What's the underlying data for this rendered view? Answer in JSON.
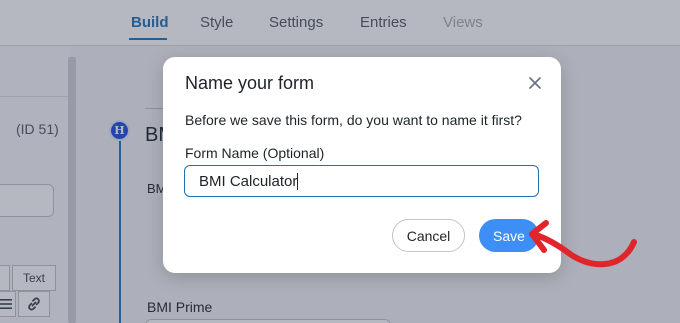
{
  "top_nav": {
    "tabs": [
      {
        "label": "Build",
        "state": "active"
      },
      {
        "label": "Style",
        "state": "normal"
      },
      {
        "label": "Settings",
        "state": "normal"
      },
      {
        "label": "Entries",
        "state": "normal"
      },
      {
        "label": "Views",
        "state": "disabled"
      }
    ]
  },
  "left_panel": {
    "form_id": "(ID 51)",
    "toolbar": {
      "text_tab": "Text"
    }
  },
  "canvas": {
    "heading_partial": "BMI",
    "label_partial": "BM",
    "bmi_prime_label": "BMI Prime"
  },
  "modal": {
    "title": "Name your form",
    "description": "Before we save this form, do you want to name it first?",
    "field_label": "Form Name (Optional)",
    "field_value": "BMI Calculator",
    "cancel_label": "Cancel",
    "save_label": "Save"
  },
  "colors": {
    "accent": "#2271b1",
    "save_button": "#3d8ff6",
    "annotation_arrow": "#e0262b"
  },
  "icons": [
    "close-icon",
    "heading-icon",
    "list-icon",
    "link-icon",
    "arrow-annotation"
  ]
}
